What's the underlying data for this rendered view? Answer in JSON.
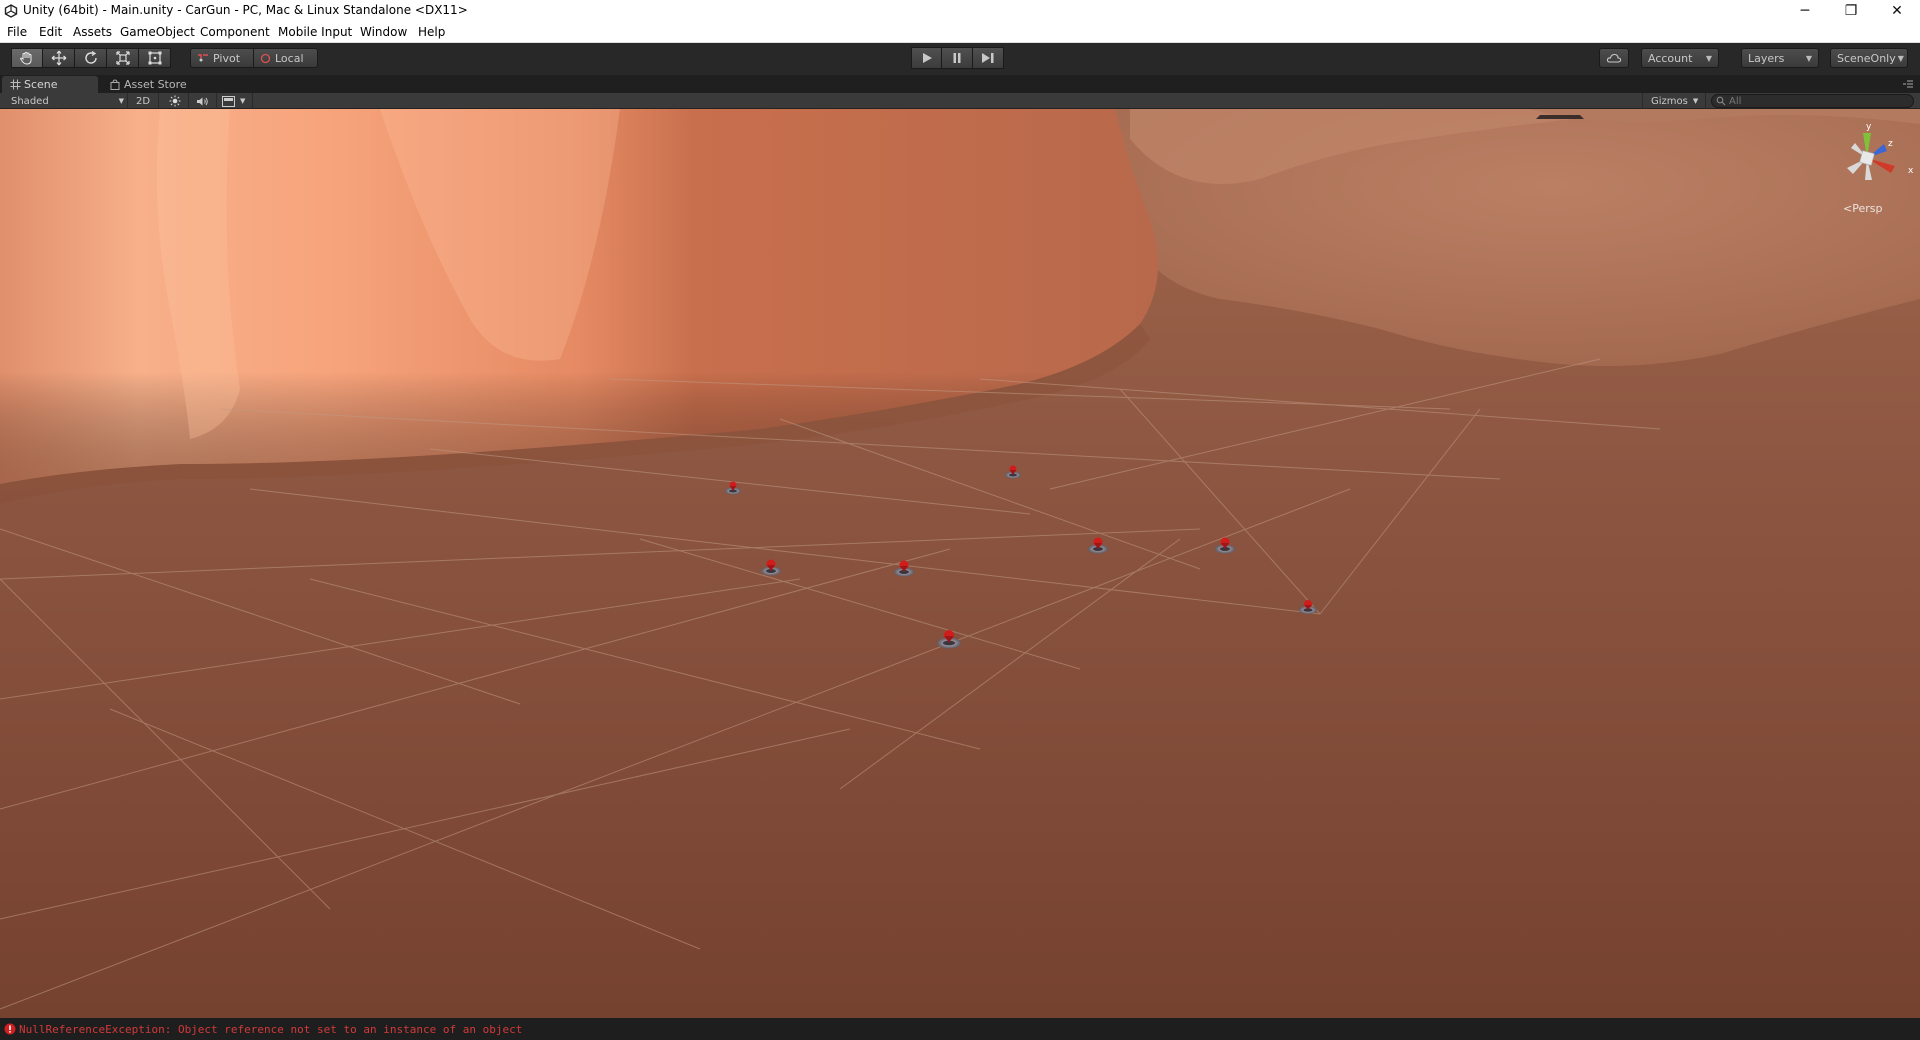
{
  "window": {
    "title": "Unity (64bit) - Main.unity - CarGun - PC, Mac & Linux Standalone <DX11>",
    "controls": {
      "minimize": "─",
      "maximize": "❐",
      "close": "✕"
    }
  },
  "menu": {
    "items": [
      "File",
      "Edit",
      "Assets",
      "GameObject",
      "Component",
      "Mobile Input",
      "Window",
      "Help"
    ]
  },
  "toolbar": {
    "transform_tools": [
      "hand-icon",
      "move-icon",
      "rotate-icon",
      "scale-icon",
      "rect-icon"
    ],
    "active_tool": "hand-icon",
    "pivot_label": "Pivot",
    "local_label": "Local",
    "playback": [
      "play-icon",
      "pause-icon",
      "step-icon"
    ],
    "account_label": "Account",
    "layers_label": "Layers",
    "layout_label": "SceneOnly"
  },
  "tabs": {
    "scene_label": "Scene",
    "asset_store_label": "Asset Store"
  },
  "scene_controls": {
    "shading_mode": "Shaded",
    "mode_2d": "2D",
    "gizmos_label": "Gizmos",
    "search_placeholder": "All"
  },
  "viewport": {
    "projection_label": "Persp",
    "gizmo_axes": {
      "y": "y",
      "z": "z",
      "x": "x"
    },
    "colors": {
      "sky_wall": "#f4a27c",
      "ground_near": "#7a4634",
      "grid_line": "#b8927e",
      "marker": "#d11c1c"
    }
  },
  "status": {
    "error_message": "NullReferenceException: Object reference not set to an instance of an object",
    "error_color": "#d23a3a"
  }
}
